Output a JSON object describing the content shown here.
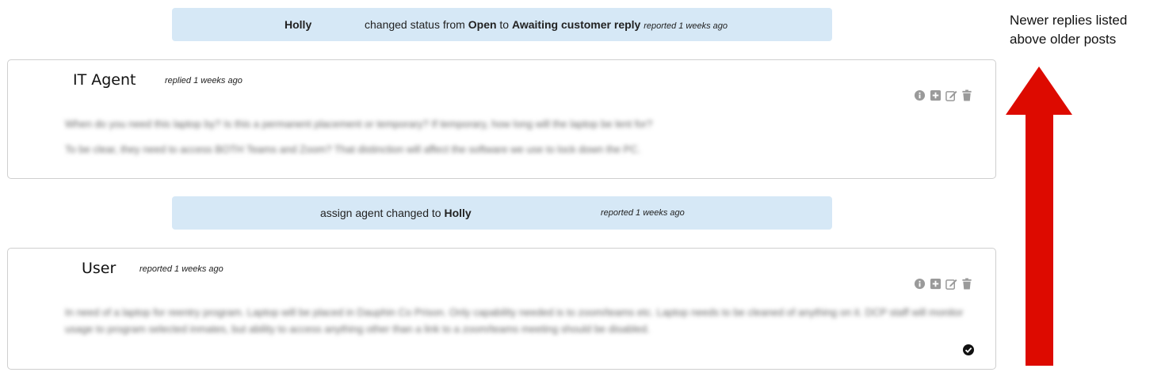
{
  "events": [
    {
      "actor": "Holly",
      "text_prefix": "changed status from",
      "from_status": "Open",
      "to_word": "to",
      "to_status": "Awaiting customer reply",
      "time": "reported 1 weeks ago"
    },
    {
      "text_prefix": "assign agent changed to",
      "actor": "Holly",
      "time": "reported 1 weeks ago"
    }
  ],
  "replies": [
    {
      "author": "IT Agent",
      "meta": "replied 1 weeks ago",
      "paragraphs": [
        "When do you need this laptop by? Is this a permanent placement or temporary? If temporary, how long will the laptop be lent for?",
        "To be clear, they need to access BOTH Teams and Zoom? That distinction will affect the software we use to lock down the PC."
      ]
    },
    {
      "author": "User",
      "meta": "reported 1 weeks ago",
      "paragraphs": [
        "In need of a laptop for reentry program. Laptop will be placed in Dauphin Co Prison. Only capability needed is to zoom/teams etc. Laptop needs to be cleaned of anything on it. DCP staff will monitor usage to program selected inmates, but ability to access anything other than a link to a zoom/teams meeting should be disabled."
      ]
    }
  ],
  "icons": [
    "info-icon",
    "add-icon",
    "edit-icon",
    "trash-icon",
    "check-circle-icon"
  ],
  "annotation": {
    "line1": "Newer replies listed",
    "line2": "above older posts"
  },
  "colors": {
    "event_bg": "#d6e8f6",
    "arrow_red": "#dd0a00",
    "icon_gray": "#9a9a9a"
  }
}
